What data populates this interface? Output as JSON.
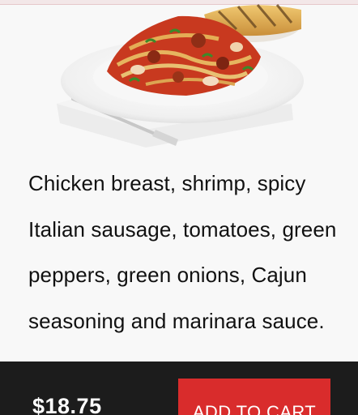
{
  "menu_item": {
    "image": "pasta-dish-image",
    "description": "Chicken breast, shrimp, spicy Italian sausage, tomatoes, green peppers, green onions, Cajun seasoning and marinara sauce."
  },
  "cart_bar": {
    "price": "$18.75",
    "add_to_cart_label": "ADD TO CART"
  },
  "colors": {
    "accent": "#d92c2c",
    "bar_background": "#1c1c1c",
    "page_background": "#f8f8f8"
  }
}
